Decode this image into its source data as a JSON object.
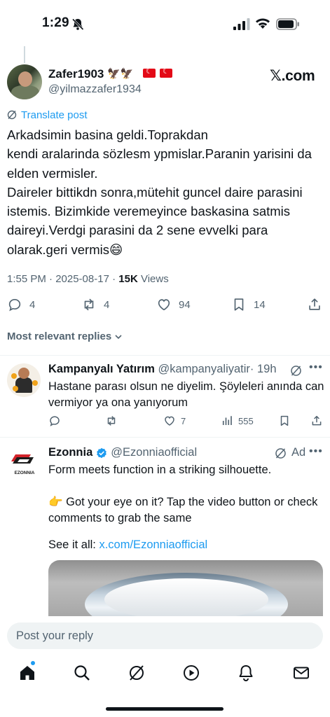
{
  "status_bar": {
    "time": "1:29"
  },
  "main_post": {
    "display_name": "Zafer1903",
    "name_emojis": "🦅🦅",
    "handle": "@yilmazzafer1934",
    "x_link": "𝕏.com",
    "translate_label": "Translate post",
    "text": "Arkadsimin basina geldi.Toprakdan\nkendi aralarinda sözlesm ypmislar.Paranin yarisini da elden vermisler.\nDaireler bittikdn sonra,mütehit  guncel daire parasini istemis. Bizimkide veremeyince baskasina satmis daireyi.Verdgi parasini da 2 sene evvelki para olarak.geri vermis😄",
    "timestamp": "1:55 PM · 2025-08-17 · ",
    "views_count": "15K",
    "views_label": " Views",
    "replies": "4",
    "reposts": "4",
    "likes": "94",
    "bookmarks": "14"
  },
  "sort": {
    "label": "Most relevant replies"
  },
  "reply": {
    "display_name": "Kampanyalı Yatırım",
    "handle": "@kampanyaliyatir",
    "time": "· 19h",
    "text": "Hastane parası olsun ne diyelim. Şöyleleri anında can vermiyor ya ona yanıyorum",
    "likes": "7",
    "views": "555"
  },
  "ad": {
    "display_name": "Ezonnia",
    "handle": "@Ezonniaofficial",
    "ad_label": "Ad",
    "logo_text": "EZONNIA",
    "text": "Form meets function in a striking silhouette.\n\n👉 Got your eye on it? Tap the video button or check comments to grab the same",
    "see_all": "See it all: ",
    "link": "x.com/Ezonniaofficial"
  },
  "composer": {
    "placeholder": "Post your reply"
  },
  "colors": {
    "accent": "#1d9bf0",
    "text": "#0f1419",
    "muted": "#536471",
    "flag": "#e30a17"
  }
}
